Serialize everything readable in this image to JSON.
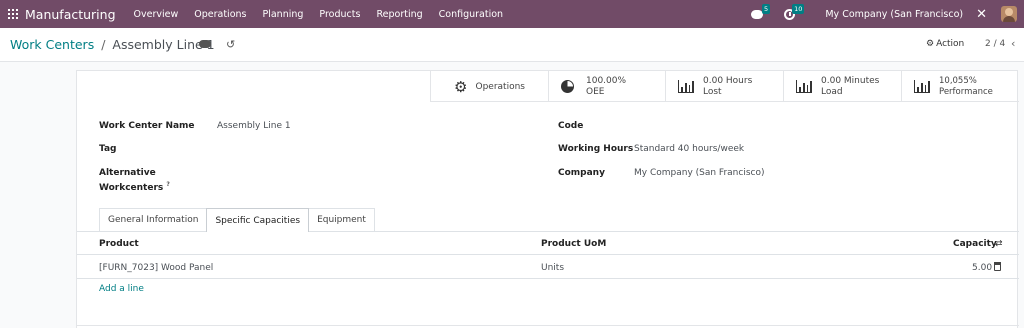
{
  "navbar": {
    "brand": "Manufacturing",
    "menu": [
      "Overview",
      "Operations",
      "Planning",
      "Products",
      "Reporting",
      "Configuration"
    ],
    "messages_count": "5",
    "activities_count": "10",
    "company": "My Company (San Francisco)"
  },
  "control": {
    "breadcrumb_parent": "Work Centers",
    "breadcrumb_sep": "/",
    "breadcrumb_current": "Assembly Line 1",
    "action_label": "Action",
    "pager": "2 / 4"
  },
  "stats": {
    "operations_label": "Operations",
    "oee_value": "100.00%",
    "oee_label": "OEE",
    "lost_value": "0.00 Hours",
    "lost_label": "Lost",
    "load_value": "0.00 Minutes",
    "load_label": "Load",
    "performance_value": "10,055%",
    "performance_label": "Performance"
  },
  "form": {
    "name_label": "Work Center Name",
    "name_value": "Assembly Line 1",
    "tag_label": "Tag",
    "alt_label_1": "Alternative",
    "alt_label_2": "Workcenters",
    "alt_help": "?",
    "code_label": "Code",
    "hours_label": "Working Hours",
    "hours_value": "Standard 40 hours/week",
    "company_label": "Company",
    "company_value": "My Company (San Francisco)"
  },
  "tabs": [
    "General Information",
    "Specific Capacities",
    "Equipment"
  ],
  "table": {
    "columns": [
      "Product",
      "Product UoM",
      "Capacity"
    ],
    "rows": [
      {
        "product": "[FURN_7023] Wood Panel",
        "uom": "Units",
        "capacity": "5.00"
      }
    ],
    "add_line": "Add a line"
  }
}
